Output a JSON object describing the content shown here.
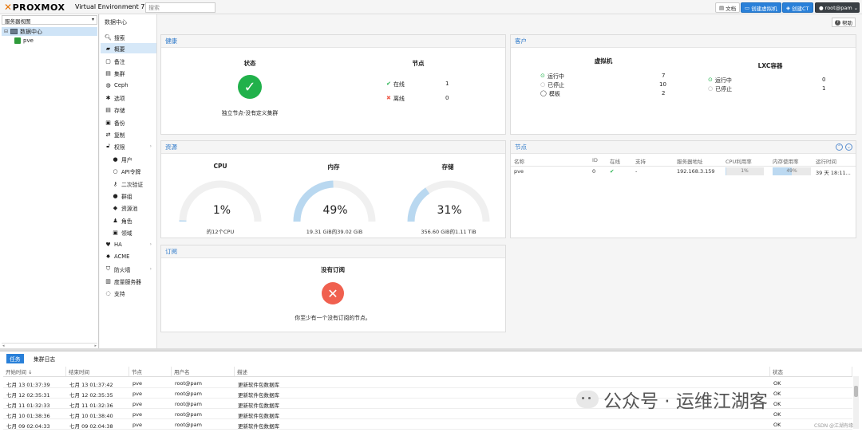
{
  "header": {
    "brand": "PROXMOX",
    "version": "Virtual Environment 7.2-3",
    "search_placeholder": "搜索",
    "docs_label": "文档",
    "create_vm_label": "创建虚拟机",
    "create_ct_label": "创建CT",
    "user_label": "root@pam"
  },
  "tree": {
    "view_label": "服务器视图",
    "datacenter": "数据中心",
    "node": "pve"
  },
  "breadcrumb": "数据中心",
  "help_label": "帮助",
  "nav": [
    {
      "label": "搜索",
      "icon": "search-icon"
    },
    {
      "label": "概要",
      "icon": "book-icon",
      "active": true
    },
    {
      "label": "备注",
      "icon": "notes-icon"
    },
    {
      "label": "集群",
      "icon": "cluster-icon"
    },
    {
      "label": "Ceph",
      "icon": "ceph-icon"
    },
    {
      "label": "选项",
      "icon": "gear-icon"
    },
    {
      "label": "存储",
      "icon": "database-icon"
    },
    {
      "label": "备份",
      "icon": "floppy-icon"
    },
    {
      "label": "复制",
      "icon": "retweet-icon"
    },
    {
      "label": "权限",
      "icon": "unlock-icon",
      "expandable": true
    },
    {
      "label": "用户",
      "icon": "user-icon",
      "sub": true
    },
    {
      "label": "API令牌",
      "icon": "user-o-icon",
      "sub": true
    },
    {
      "label": "二次验证",
      "icon": "key-icon",
      "sub": true
    },
    {
      "label": "群组",
      "icon": "users-icon",
      "sub": true
    },
    {
      "label": "资源池",
      "icon": "tags-icon",
      "sub": true
    },
    {
      "label": "角色",
      "icon": "male-icon",
      "sub": true
    },
    {
      "label": "领域",
      "icon": "address-book-icon",
      "sub": true
    },
    {
      "label": "HA",
      "icon": "heartbeat-icon",
      "expandable": true
    },
    {
      "label": "ACME",
      "icon": "certificate-icon"
    },
    {
      "label": "防火墙",
      "icon": "shield-icon",
      "expandable": true
    },
    {
      "label": "度量服务器",
      "icon": "bar-chart-icon"
    },
    {
      "label": "支持",
      "icon": "comments-icon"
    }
  ],
  "health": {
    "title": "健康",
    "status_title": "状态",
    "status_text": "独立节点-没有定义集群",
    "nodes_title": "节点",
    "online_label": "在线",
    "online_count": "1",
    "offline_label": "离线",
    "offline_count": "0"
  },
  "guests": {
    "title": "客户",
    "vm_title": "虚拟机",
    "vm_running_label": "运行中",
    "vm_running": "7",
    "vm_stopped_label": "已停止",
    "vm_stopped": "10",
    "vm_template_label": "模板",
    "vm_template": "2",
    "lxc_title": "LXC容器",
    "lxc_running_label": "运行中",
    "lxc_running": "0",
    "lxc_stopped_label": "已停止",
    "lxc_stopped": "1"
  },
  "resources": {
    "title": "资源",
    "cpu": {
      "title": "CPU",
      "value_text": "1%",
      "fraction": 0.01,
      "sub": "的12个CPU"
    },
    "memory": {
      "title": "内存",
      "value_text": "49%",
      "fraction": 0.49,
      "sub": "19.31 GiB的39.02 GiB"
    },
    "storage": {
      "title": "存储",
      "value_text": "31%",
      "fraction": 0.31,
      "sub": "356.60 GiB的1.11 TiB"
    }
  },
  "nodes_panel": {
    "title": "节点",
    "columns": [
      "名称",
      "ID",
      "在线",
      "支持",
      "服务器地址",
      "CPU利用率",
      "内存使用率",
      "运行时间"
    ],
    "rows": [
      {
        "name": "pve",
        "id": "0",
        "support": "-",
        "address": "192.168.3.159",
        "cpu": "1%",
        "cpu_fraction": 0.01,
        "mem": "49%",
        "mem_fraction": 0.49,
        "uptime": "39 天 18:11..."
      }
    ]
  },
  "subscription": {
    "title": "订阅",
    "heading": "没有订阅",
    "text": "你至少有一个没有订阅的节点。"
  },
  "tasks": {
    "tab_tasks": "任务",
    "tab_cluster_log": "集群日志",
    "columns": [
      "开始时间 ↓",
      "结束时间",
      "节点",
      "用户名",
      "描述",
      "状态"
    ],
    "rows": [
      {
        "start": "七月 13 01:37:39",
        "end": "七月 13 01:37:42",
        "node": "pve",
        "user": "root@pam",
        "desc": "更新软件包数据库",
        "status": "OK"
      },
      {
        "start": "七月 12 02:35:31",
        "end": "七月 12 02:35:35",
        "node": "pve",
        "user": "root@pam",
        "desc": "更新软件包数据库",
        "status": "OK"
      },
      {
        "start": "七月 11 01:32:33",
        "end": "七月 11 01:32:36",
        "node": "pve",
        "user": "root@pam",
        "desc": "更新软件包数据库",
        "status": "OK"
      },
      {
        "start": "七月 10 01:38:36",
        "end": "七月 10 01:38:40",
        "node": "pve",
        "user": "root@pam",
        "desc": "更新软件包数据库",
        "status": "OK"
      },
      {
        "start": "七月 09 02:04:33",
        "end": "七月 09 02:04:38",
        "node": "pve",
        "user": "root@pam",
        "desc": "更新软件包数据库",
        "status": "OK"
      }
    ]
  },
  "watermark": {
    "text": "公众号 · 运维江湖客",
    "csdn": "CSDN @江湖有缘"
  },
  "colors": {
    "accent": "#2980d9",
    "ok": "#21b14b",
    "error": "#f0604f",
    "gauge": "#b9d8f0"
  }
}
